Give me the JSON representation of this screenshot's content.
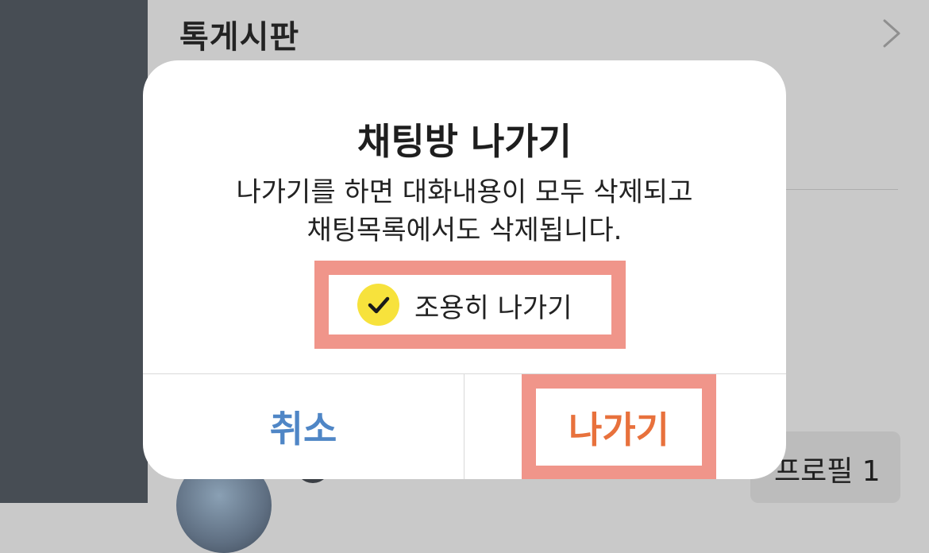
{
  "background": {
    "board_title": "톡게시판",
    "profile_button_label": "프로필 1"
  },
  "dialog": {
    "title": "채팅방 나가기",
    "message_line1": "나가기를 하면 대화내용이 모두 삭제되고",
    "message_line2": "채팅목록에서도 삭제됩니다.",
    "quiet_leave": {
      "label": "조용히 나가기",
      "checked": true
    },
    "cancel_label": "취소",
    "leave_label": "나가기"
  },
  "colors": {
    "cancel": "#4f86c6",
    "leave": "#e8713c",
    "check_circle": "#f7e23c",
    "highlight": "#f0958a"
  }
}
